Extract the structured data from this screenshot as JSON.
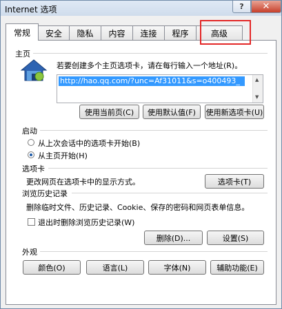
{
  "window": {
    "title": "Internet 选项",
    "help_glyph": "?",
    "close_glyph": "✕"
  },
  "tabs": [
    "常规",
    "安全",
    "隐私",
    "内容",
    "连接",
    "程序",
    "高级"
  ],
  "home": {
    "section": "主页",
    "description": "若要创建多个主页选项卡，请在每行输入一个地址(R)。",
    "url": "http://hao.qq.com/?unc=Af31011&s=o400493_",
    "buttons": [
      "使用当前页(C)",
      "使用默认值(F)",
      "使用新选项卡(U)"
    ]
  },
  "startup": {
    "section": "启动",
    "options": [
      {
        "label": "从上次会话中的选项卡开始(B)",
        "selected": false
      },
      {
        "label": "从主页开始(H)",
        "selected": true
      }
    ]
  },
  "tabs_section": {
    "section": "选项卡",
    "description": "更改网页在选项卡中的显示方式。",
    "button": "选项卡(T)"
  },
  "history": {
    "section": "浏览历史记录",
    "description": "删除临时文件、历史记录、Cookie、保存的密码和网页表单信息。",
    "checkbox": {
      "label": "退出时删除浏览历史记录(W)",
      "checked": false
    },
    "delete_button": "删除(D)...",
    "settings_button": "设置(S)"
  },
  "appearance": {
    "section": "外观",
    "buttons": [
      "颜色(O)",
      "语言(L)",
      "字体(N)",
      "辅助功能(E)"
    ]
  },
  "colors": {
    "highlight": "#e32626",
    "selection": "#3399ff",
    "radio_dot": "#1d5aa8"
  }
}
